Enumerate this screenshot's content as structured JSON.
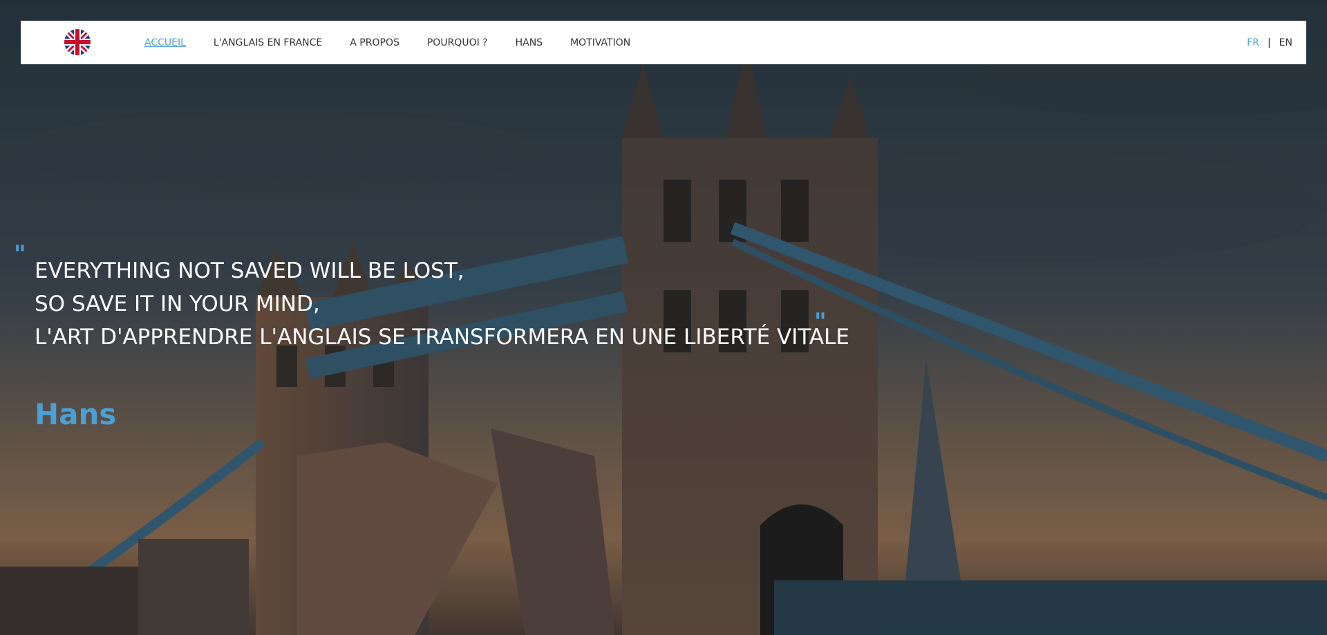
{
  "nav": {
    "logo": "union-jack-flag-icon",
    "items": [
      {
        "label": "ACCUEIL",
        "active": true
      },
      {
        "label": "L'ANGLAIS EN FRANCE",
        "active": false
      },
      {
        "label": "A PROPOS",
        "active": false
      },
      {
        "label": "POURQUOI ?",
        "active": false
      },
      {
        "label": "HANS",
        "active": false
      },
      {
        "label": "MOTIVATION",
        "active": false
      }
    ],
    "lang": {
      "fr": "FR",
      "separator": "|",
      "en": "EN",
      "selected": "FR"
    }
  },
  "hero": {
    "background": "tower-bridge-photo",
    "quote_open": "\"",
    "quote_close": "\"",
    "quote_lines": [
      "EVERYTHING NOT SAVED WILL BE LOST,",
      "SO SAVE IT IN YOUR MIND,",
      "L'ART D'APPRENDRE L'ANGLAIS SE TRANSFORMERA EN UNE LIBERTÉ VITALE"
    ],
    "author": "Hans"
  },
  "colors": {
    "accent": "#4a9fd5",
    "nav_bg": "#ffffff",
    "nav_text": "#333333",
    "quote_text": "#ffffff"
  }
}
